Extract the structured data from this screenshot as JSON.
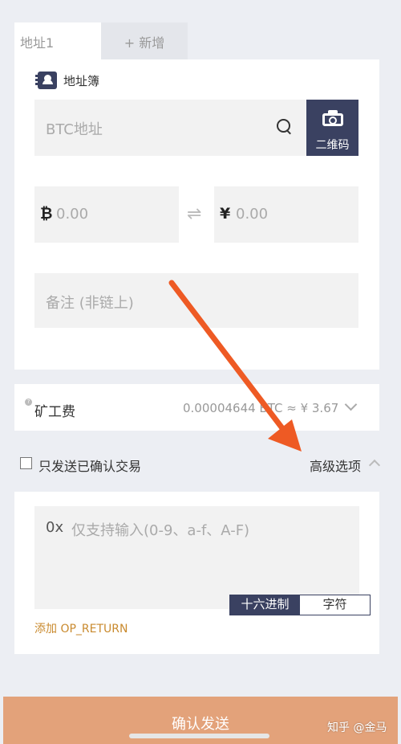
{
  "tabs": {
    "active": "地址1",
    "add": "+ 新增"
  },
  "address_book": {
    "label": "地址簿",
    "icon": "address-book-icon"
  },
  "btc_address": {
    "placeholder": "BTC地址",
    "search_icon": "search-icon"
  },
  "qr_button": {
    "label": "二维码",
    "icon": "camera-icon"
  },
  "amount": {
    "btc_symbol": "₿",
    "btc_placeholder": "0.00",
    "swap_icon": "⇌",
    "cny_symbol": "¥",
    "cny_placeholder": "0.00"
  },
  "note": {
    "placeholder": "备注 (非链上)"
  },
  "fee": {
    "label": "矿工费",
    "value": "0.00004644 BTC ≈ ¥ 3.67"
  },
  "options": {
    "confirmed_only": "只发送已确认交易",
    "advanced": "高级选项"
  },
  "op_return": {
    "prefix": "0x",
    "placeholder": "仅支持输入(0-9、a-f、A-F)",
    "mode_hex": "十六进制",
    "mode_text": "字符",
    "add_label": "添加 OP_RETURN"
  },
  "confirm": {
    "label": "确认发送"
  },
  "watermark": "知乎 @金马",
  "colors": {
    "primary": "#3a4161",
    "accent": "#c98a2e",
    "confirm_bg": "#e3a27a",
    "arrow": "#ee5a24"
  }
}
